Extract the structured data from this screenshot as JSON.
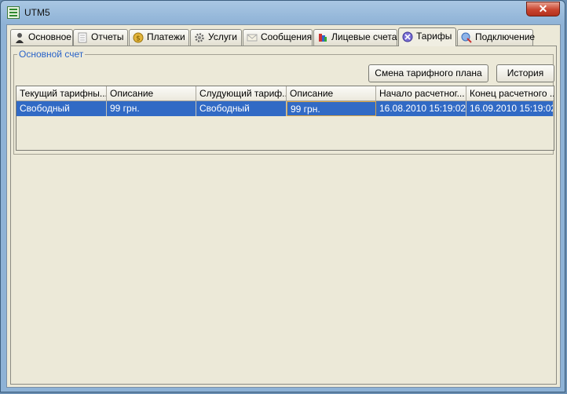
{
  "window": {
    "title": "UTM5",
    "close_label": "✕"
  },
  "tabs": [
    {
      "label": "Основное",
      "icon": "user-icon"
    },
    {
      "label": "Отчеты",
      "icon": "document-icon"
    },
    {
      "label": "Платежи",
      "icon": "coin-icon"
    },
    {
      "label": "Услуги",
      "icon": "gear-icon"
    },
    {
      "label": "Сообщения",
      "icon": "envelope-icon"
    },
    {
      "label": "Лицевые счета",
      "icon": "accounts-icon"
    },
    {
      "label": "Тарифы",
      "icon": "tariff-icon",
      "active": true
    },
    {
      "label": "Подключение",
      "icon": "connection-icon"
    }
  ],
  "group": {
    "title": "Основной счет",
    "change_plan_label": "Смена тарифного плана",
    "history_label": "История"
  },
  "table": {
    "columns": [
      "Текущий тарифны...",
      "Описание",
      "Слудующий тариф...",
      "Описание",
      "Начало расчетног...",
      "Конец расчетного ..."
    ],
    "rows": [
      [
        "Свободный",
        "99 грн.",
        "Свободный",
        "99 грн.",
        "16.08.2010 15:19:02",
        "16.09.2010 15:19:02"
      ]
    ]
  },
  "colors": {
    "selection": "#316ac5",
    "group_title": "#2a63c8",
    "panel": "#ece9d8",
    "titlebar": "#8eb2d6"
  }
}
